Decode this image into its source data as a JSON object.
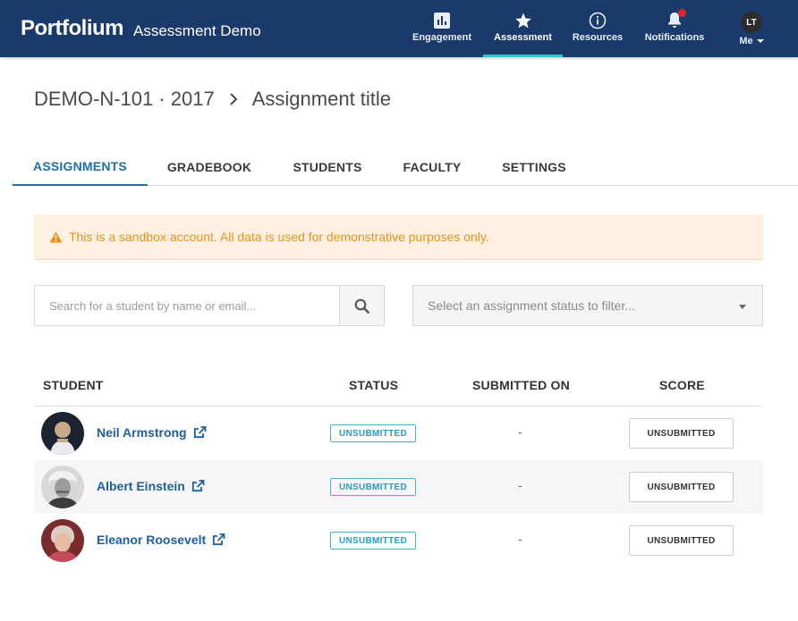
{
  "header": {
    "logo": "Portfolium",
    "app_title": "Assessment Demo",
    "nav": [
      {
        "label": "Engagement",
        "icon": "bar-chart-icon"
      },
      {
        "label": "Assessment",
        "icon": "star-icon",
        "active": true
      },
      {
        "label": "Resources",
        "icon": "info-icon"
      },
      {
        "label": "Notifications",
        "icon": "bell-icon",
        "has_notification": true
      },
      {
        "label": "Me",
        "icon": "avatar-icon",
        "initials": "LT"
      }
    ]
  },
  "breadcrumb": {
    "course": "DEMO-N-101 · 2017",
    "current": "Assignment title"
  },
  "tabs": [
    {
      "label": "ASSIGNMENTS",
      "active": true
    },
    {
      "label": "GRADEBOOK"
    },
    {
      "label": "STUDENTS"
    },
    {
      "label": "FACULTY"
    },
    {
      "label": "SETTINGS"
    }
  ],
  "alert": {
    "text": "This is a sandbox account. All data is used for demonstrative purposes only."
  },
  "search": {
    "placeholder": "Search for a student by name or email...",
    "value": ""
  },
  "status_filter": {
    "placeholder": "Select an assignment status to filter..."
  },
  "table": {
    "columns": [
      "STUDENT",
      "STATUS",
      "SUBMITTED ON",
      "SCORE"
    ],
    "rows": [
      {
        "name": "Neil Armstrong",
        "status": "UNSUBMITTED",
        "submitted_on": "-",
        "score": "UNSUBMITTED"
      },
      {
        "name": "Albert Einstein",
        "status": "UNSUBMITTED",
        "submitted_on": "-",
        "score": "UNSUBMITTED"
      },
      {
        "name": "Eleanor Roosevelt",
        "status": "UNSUBMITTED",
        "submitted_on": "-",
        "score": "UNSUBMITTED"
      }
    ]
  },
  "colors": {
    "nav_bg": "#1a3a6b",
    "accent": "#1a6fb4",
    "active_nav_underline": "#3cc3c3",
    "alert_bg": "#fdf0e1",
    "alert_text": "#e8921b",
    "badge": "#2a9cc2"
  }
}
